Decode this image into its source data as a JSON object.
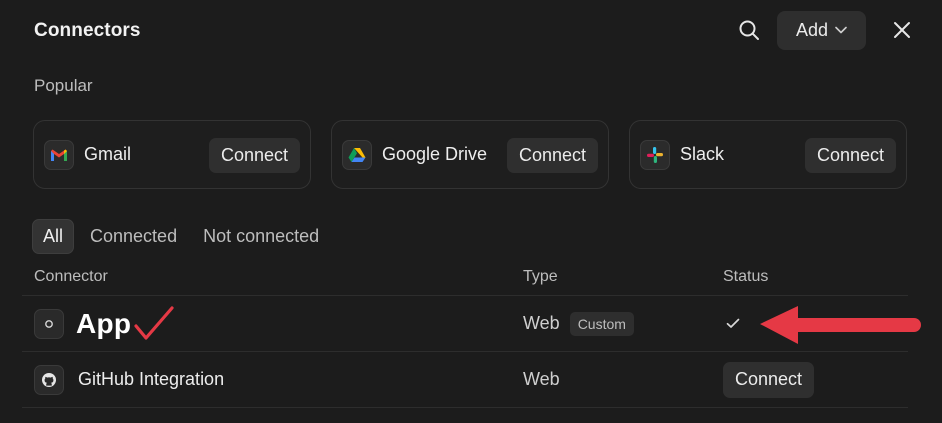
{
  "header": {
    "title": "Connectors",
    "add_label": "Add"
  },
  "popular": {
    "label": "Popular",
    "cards": [
      {
        "name": "Gmail",
        "connect_label": "Connect",
        "icon": "gmail-icon"
      },
      {
        "name": "Google Drive",
        "connect_label": "Connect",
        "icon": "google-drive-icon"
      },
      {
        "name": "Slack",
        "connect_label": "Connect",
        "icon": "slack-icon"
      }
    ]
  },
  "filters": [
    "All",
    "Connected",
    "Not connected"
  ],
  "active_filter": "All",
  "table": {
    "columns": [
      "Connector",
      "Type",
      "Status"
    ],
    "rows": [
      {
        "name": "App",
        "type": "Web",
        "badge": "Custom",
        "status": "connected",
        "icon": "app-circle-icon"
      },
      {
        "name": "GitHub Integration",
        "type": "Web",
        "status_label": "Connect",
        "icon": "github-icon"
      }
    ]
  },
  "colors": {
    "background": "#1c1c1c",
    "surface": "#2f2f2f",
    "annotation_red": "#e53945"
  }
}
